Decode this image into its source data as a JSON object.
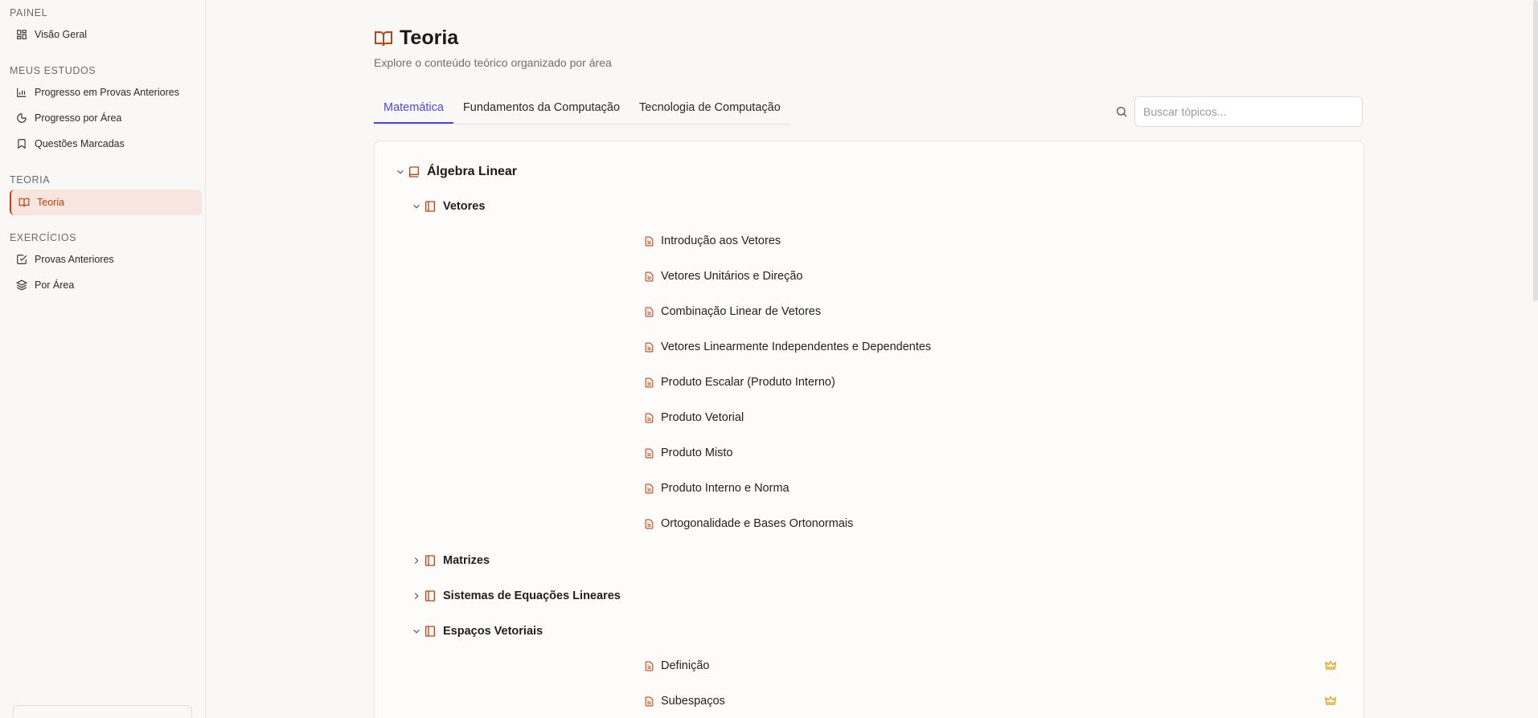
{
  "sidebar": {
    "sections": [
      {
        "title": "PAINEL",
        "items": [
          {
            "label": "Visão Geral",
            "icon": "dashboard-icon"
          }
        ]
      },
      {
        "title": "MEUS ESTUDOS",
        "items": [
          {
            "label": "Progresso em Provas Anteriores",
            "icon": "bar-chart-icon"
          },
          {
            "label": "Progresso por Área",
            "icon": "pie-chart-icon"
          },
          {
            "label": "Questões Marcadas",
            "icon": "bookmark-icon"
          }
        ]
      },
      {
        "title": "TEORIA",
        "items": [
          {
            "label": "Teoria",
            "icon": "book-open-icon",
            "active": true
          }
        ]
      },
      {
        "title": "EXERCÍCIOS",
        "items": [
          {
            "label": "Provas Anteriores",
            "icon": "check-square-icon"
          },
          {
            "label": "Por Área",
            "icon": "layers-icon"
          }
        ]
      }
    ]
  },
  "header": {
    "title": "Teoria",
    "subtitle": "Explore o conteúdo teórico organizado por área"
  },
  "tabs": [
    {
      "label": "Matemática",
      "active": true
    },
    {
      "label": "Fundamentos da Computação",
      "active": false
    },
    {
      "label": "Tecnologia de Computação",
      "active": false
    }
  ],
  "search": {
    "placeholder": "Buscar tópicos...",
    "value": ""
  },
  "tree": {
    "area": "Álgebra Linear",
    "chapters": [
      {
        "label": "Vetores",
        "expanded": true,
        "topics": [
          "Introdução aos Vetores",
          "Vetores Unitários e Direção",
          "Combinação Linear de Vetores",
          "Vetores Linearmente Independentes e Dependentes",
          "Produto Escalar (Produto Interno)",
          "Produto Vetorial",
          "Produto Misto",
          "Produto Interno e Norma",
          "Ortogonalidade e Bases Ortonormais"
        ]
      },
      {
        "label": "Matrizes",
        "expanded": false
      },
      {
        "label": "Sistemas de Equações Lineares",
        "expanded": false
      },
      {
        "label": "Espaços Vetoriais",
        "expanded": true,
        "topics": [
          "Definição",
          "Subespaços"
        ],
        "premium_icon": "crown-icon"
      }
    ]
  },
  "colors": {
    "accent": "#c2410c",
    "tab_active": "#4f46e5",
    "crown": "#d9a10b"
  }
}
